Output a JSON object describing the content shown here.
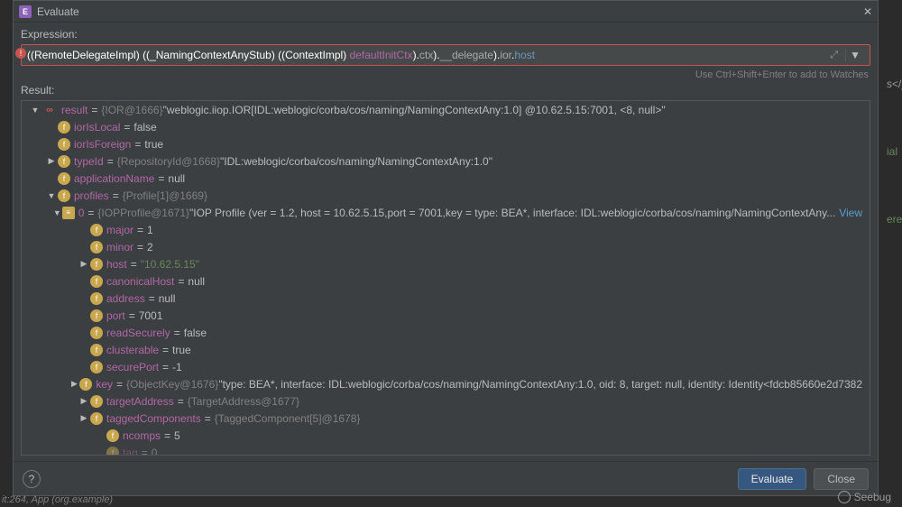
{
  "window": {
    "title": "Evaluate",
    "close_glyph": "✕",
    "icon_glyph": "E"
  },
  "labels": {
    "expression": "Expression:",
    "result": "Result:",
    "hint": "Use Ctrl+Shift+Enter to add to Watches",
    "view": "View"
  },
  "expression": {
    "tokens": [
      {
        "t": "((",
        "c": "t-white"
      },
      {
        "t": "RemoteDelegateImpl",
        "c": "t-white"
      },
      {
        "t": ") ((",
        "c": "t-white"
      },
      {
        "t": "_NamingContextAnyStub",
        "c": "t-white"
      },
      {
        "t": ") ((",
        "c": "t-white"
      },
      {
        "t": "ContextImpl",
        "c": "t-white"
      },
      {
        "t": ") ",
        "c": "t-white"
      },
      {
        "t": "defaultInitCtx",
        "c": "t-pink"
      },
      {
        "t": ").",
        "c": "t-white"
      },
      {
        "t": "ctx",
        "c": "t-gray"
      },
      {
        "t": ").",
        "c": "t-white"
      },
      {
        "t": "__delegate",
        "c": "t-gray"
      },
      {
        "t": ").",
        "c": "t-white"
      },
      {
        "t": "ior",
        "c": "t-gray"
      },
      {
        "t": ".",
        "c": "t-white"
      },
      {
        "t": "host",
        "c": "t-blue"
      }
    ]
  },
  "tree": [
    {
      "d": 0,
      "tg": "▼",
      "b": "oo",
      "bg": "∞",
      "n": "result",
      "eq": "=",
      "dim": "{IOR@1666}",
      "v": " \"weblogic.iiop.IOR[IDL:weblogic/corba/cos/naming/NamingContextAny:1.0] @10.62.5.15:7001, <8, null>\"",
      "vs": false
    },
    {
      "d": 1,
      "tg": "",
      "b": "f",
      "bg": "f",
      "n": "iorIsLocal",
      "eq": "=",
      "v": " false"
    },
    {
      "d": 1,
      "tg": "",
      "b": "f",
      "bg": "f",
      "n": "iorIsForeign",
      "eq": "=",
      "v": " true"
    },
    {
      "d": 1,
      "tg": "▶",
      "b": "f",
      "bg": "f",
      "n": "typeId",
      "eq": "=",
      "dim": "{RepositoryId@1668}",
      "v": " \"IDL:weblogic/corba/cos/naming/NamingContextAny:1.0\""
    },
    {
      "d": 1,
      "tg": "",
      "b": "f",
      "bg": "f",
      "n": "applicationName",
      "eq": "=",
      "v": " null"
    },
    {
      "d": 1,
      "tg": "▼",
      "b": "f",
      "bg": "f",
      "n": "profiles",
      "eq": "=",
      "dim": "{Profile[1]@1669}"
    },
    {
      "d": 2,
      "tg": "▼",
      "b": "arr",
      "bg": "≡",
      "n": "0",
      "eq": "=",
      "dim": "{IOPProfile@1671}",
      "v": " \"IOP Profile (ver = 1.2, host = 10.62.5.15,port = 7001,key = type: BEA*, interface: IDL:weblogic/corba/cos/naming/NamingContextAny...",
      "link": true
    },
    {
      "d": 3,
      "tg": "",
      "b": "f",
      "bg": "f",
      "n": "major",
      "eq": "=",
      "v": " 1"
    },
    {
      "d": 3,
      "tg": "",
      "b": "f",
      "bg": "f",
      "n": "minor",
      "eq": "=",
      "v": " 2"
    },
    {
      "d": 3,
      "tg": "▶",
      "b": "f",
      "bg": "f",
      "n": "host",
      "eq": "=",
      "v": " \"10.62.5.15\"",
      "vs": true
    },
    {
      "d": 3,
      "tg": "",
      "b": "f",
      "bg": "f",
      "n": "canonicalHost",
      "eq": "=",
      "v": " null"
    },
    {
      "d": 3,
      "tg": "",
      "b": "f",
      "bg": "f",
      "n": "address",
      "eq": "=",
      "v": " null"
    },
    {
      "d": 3,
      "tg": "",
      "b": "f",
      "bg": "f",
      "n": "port",
      "eq": "=",
      "v": " 7001"
    },
    {
      "d": 3,
      "tg": "",
      "b": "f",
      "bg": "f",
      "n": "readSecurely",
      "eq": "=",
      "v": " false"
    },
    {
      "d": 3,
      "tg": "",
      "b": "f",
      "bg": "f",
      "n": "clusterable",
      "eq": "=",
      "v": " true"
    },
    {
      "d": 3,
      "tg": "",
      "b": "f",
      "bg": "f",
      "n": "securePort",
      "eq": "=",
      "v": " -1"
    },
    {
      "d": 3,
      "tg": "▶",
      "b": "f",
      "bg": "f",
      "n": "key",
      "eq": "=",
      "dim": "{ObjectKey@1676}",
      "v": " \"type: BEA*, interface: IDL:weblogic/corba/cos/naming/NamingContextAny:1.0, oid: 8, target: null, identity: Identity<fdcb85660e2d7382"
    },
    {
      "d": 3,
      "tg": "▶",
      "b": "f",
      "bg": "f",
      "n": "targetAddress",
      "eq": "=",
      "dim": "{TargetAddress@1677}"
    },
    {
      "d": 3,
      "tg": "▶",
      "b": "f",
      "bg": "f",
      "n": "taggedComponents",
      "eq": "=",
      "dim": "{TaggedComponent[5]@1678}"
    },
    {
      "d": 4,
      "tg": "",
      "b": "f",
      "bg": "f",
      "n": "ncomps",
      "eq": "=",
      "v": " 5"
    },
    {
      "d": 4,
      "tg": "",
      "b": "f",
      "bg": "f",
      "n": "tag",
      "eq": "=",
      "v": " 0",
      "faded": true
    }
  ],
  "buttons": {
    "evaluate": "Evaluate",
    "close": "Close",
    "help": "?"
  },
  "status": "it:264, App (org.example)",
  "watermark": "Seebug",
  "bg_code": [
    "s</j",
    "ial",
    "ere"
  ]
}
